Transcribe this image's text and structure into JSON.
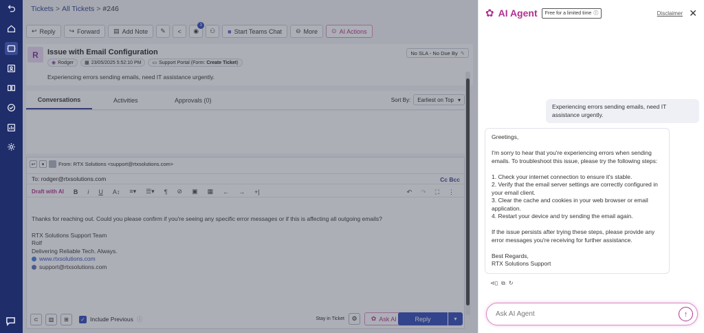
{
  "breadcrumb": {
    "tickets": "Tickets",
    "all": "All Tickets",
    "id": "#246",
    "sep": ">"
  },
  "toolbar": {
    "reply": "Reply",
    "forward": "Forward",
    "add_note": "Add Note",
    "watch_count": "3",
    "teams_chat": "Start Teams Chat",
    "more": "More",
    "ai_actions": "AI Actions"
  },
  "ticket": {
    "avatar": "R",
    "title": "Issue with Email Configuration",
    "requester": "Rodger",
    "date": "23/05/2025 5:52:10 PM",
    "source_prefix": "Support Portal (Form: ",
    "source_form": "Create Ticket",
    "source_suffix": ")",
    "description": "Experiencing errors sending emails, need IT assistance urgently.",
    "sla": "No SLA - No Due By"
  },
  "tabs": {
    "conversations": "Conversations",
    "activities": "Activities",
    "approvals": "Approvals (0)",
    "sort_label": "Sort By:",
    "sort_value": "Earliest on Top"
  },
  "composer": {
    "from": "From: RTX Solutions <support@rtxsolutions.com>",
    "to": "To: rodger@rtxsolutions.com",
    "cc": "Cc",
    "bcc": "Bcc",
    "draft_ai": "Draft with AI",
    "body_line1": "Thanks for reaching out. Could you please confirm if you're seeing any specific error messages or if this is affecting all outgoing emails?",
    "sig_team": "RTX Solutions Support Team",
    "sig_name": "Rolf",
    "sig_tagline": "Delivering Reliable Tech. Always.",
    "sig_web": "www.rtxsolutions.com",
    "sig_email": "support@rtxsolutions.com",
    "include_previous": "Include Previous",
    "stay_in_ticket": "Stay in Ticket",
    "ask_ai": "Ask AI Agent",
    "reply": "Reply"
  },
  "panel": {
    "title": "AI Agent",
    "free_badge": "Free for a limited time",
    "disclaimer": "Disclaimer",
    "user_msg": "Experiencing errors sending emails, need IT assistance urgently.",
    "bot": {
      "greeting": "Greetings,",
      "intro": "I'm sorry to hear that you're experiencing errors when sending emails. To troubleshoot this issue, please try the following steps:",
      "step1": "1. Check your internet connection to ensure it's stable.",
      "step2": "2. Verify that the email server settings are correctly configured in your email client.",
      "step3": "3. Clear the cache and cookies in your web browser or email application.",
      "step4": "4. Restart your device and try sending the email again.",
      "outro": "If the issue persists after trying these steps, please provide any error messages you're receiving for further assistance.",
      "signoff": "Best Regards,",
      "signature": "RTX Solutions Support"
    },
    "ask_placeholder": "Ask AI Agent"
  }
}
